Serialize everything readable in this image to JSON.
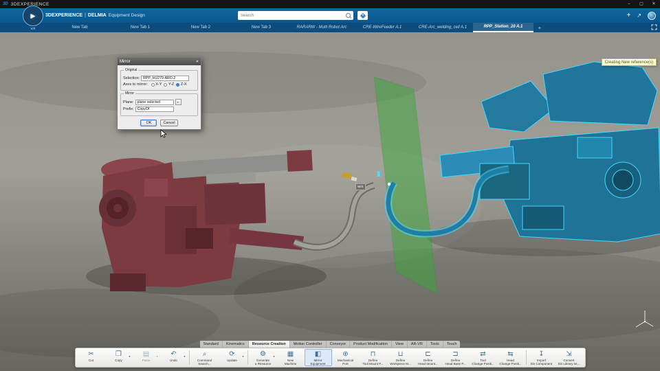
{
  "window": {
    "logo": "3D",
    "title": "3DEXPERIENCE",
    "minimize": "–",
    "maximize": "▢",
    "close": "✕"
  },
  "header": {
    "brand": "3DEXPERIENCE",
    "divider": "|",
    "app": "DELMIA",
    "module": "Equipment Design",
    "search_placeholder": "Search",
    "compass_play": "▶",
    "compass_version": "V.R",
    "actions": {
      "add": "+",
      "share": "↗"
    }
  },
  "tabbar": {
    "tabs": [
      {
        "label": "New Tab"
      },
      {
        "label": "New Tab 1"
      },
      {
        "label": "New Tab 2"
      },
      {
        "label": "New Tab 3"
      },
      {
        "label": "RARARW - Multi Robot Arc",
        "italic": true
      },
      {
        "label": "CRE-WireFeeder A.1",
        "italic": true
      },
      {
        "label": "CRE-Arc_welding_cell A.1",
        "italic": true
      },
      {
        "label": "RPP_Station_20 A.1",
        "italic": true,
        "active": true
      },
      {
        "label": "+",
        "plus": true
      }
    ]
  },
  "viewport": {
    "tooltip": "Creating New reference(s)",
    "frame_label": "W/X",
    "colors": {
      "floor_top": "#95938c",
      "floor_mid": "#a09e97",
      "floor_bottom": "#686660",
      "plane_green": "#3aa83a",
      "red_machine": "#7c3a41",
      "blue_machine": "#1f7396",
      "selection_cyan": "#3fd9ff"
    }
  },
  "dialog": {
    "title": "Mirror",
    "close": "✕",
    "groups": {
      "original": "Original",
      "mirror": "Mirror"
    },
    "selection_label": "Selection:",
    "selection_value": "RPP_HU279-ARO.2",
    "axes_label": "Axes to mirror:",
    "axes": [
      {
        "label": "X-Y"
      },
      {
        "label": "Y-Z"
      },
      {
        "label": "Z-X",
        "selected": true
      }
    ],
    "plane_label": "Plane:",
    "plane_value": "plane selected",
    "picker_glyph": "▸",
    "prefix_label": "Prefix:",
    "prefix_value": "CopyOf",
    "ok": "OK",
    "cancel": "Cancel"
  },
  "ribbon": {
    "caret_glyph": "▾",
    "tabs": [
      {
        "label": "Standard"
      },
      {
        "label": "Kinematics"
      },
      {
        "label": "Resource Creation",
        "active": true
      },
      {
        "label": "Motion Controller"
      },
      {
        "label": "Conveyor"
      },
      {
        "label": "Product Modification"
      },
      {
        "label": "View"
      },
      {
        "label": "AR-VR"
      },
      {
        "label": "Tools"
      },
      {
        "label": "Touch"
      }
    ],
    "tools": [
      {
        "label": "Cut",
        "icon": "scissors-icon",
        "glyph": "✂"
      },
      {
        "label": "Copy",
        "icon": "copy-icon",
        "glyph": "❐",
        "caret": true
      },
      {
        "label": "Paste",
        "icon": "paste-icon",
        "glyph": "▤",
        "caret": true,
        "disabled": true
      },
      {
        "label": "Undo",
        "icon": "undo-icon",
        "glyph": "↶",
        "caret": true
      },
      {
        "sep": true
      },
      {
        "label": "Command\nSearch...",
        "icon": "command-search-icon",
        "glyph": "⌕"
      },
      {
        "label": "Update",
        "icon": "update-icon",
        "glyph": "⟳",
        "caret": true
      },
      {
        "sep": true
      },
      {
        "label": "Generate\na Resource",
        "icon": "generate-resource-icon",
        "glyph": "⚙",
        "caret": true
      },
      {
        "label": "New\nMachine",
        "icon": "new-machine-icon",
        "glyph": "▦"
      },
      {
        "label": "Mirror\nEquipment",
        "icon": "mirror-equipment-icon",
        "glyph": "◧",
        "active": true
      },
      {
        "label": "Mechanical\nPort",
        "icon": "mechanical-port-icon",
        "glyph": "⊕"
      },
      {
        "label": "Define\nTool Mount P...",
        "icon": "define-tool-mount-icon",
        "glyph": "⊓"
      },
      {
        "label": "Define\nWorkpiece M...",
        "icon": "define-workpiece-icon",
        "glyph": "⊔"
      },
      {
        "label": "Define\nHead Mount...",
        "icon": "define-head-mount-icon",
        "glyph": "⊏"
      },
      {
        "label": "Define\nHead Base P...",
        "icon": "define-head-base-icon",
        "glyph": "⊐"
      },
      {
        "label": "Tool\nChange Positi...",
        "icon": "tool-change-position-icon",
        "glyph": "⇄"
      },
      {
        "label": "Head\nChange Positi...",
        "icon": "head-change-position-icon",
        "glyph": "⇆"
      },
      {
        "sep": true
      },
      {
        "label": "Import\nDS Component",
        "icon": "import-ds-component-icon",
        "glyph": "↧"
      },
      {
        "label": "Convert\nDS Library int...",
        "icon": "convert-ds-library-icon",
        "glyph": "⇲"
      }
    ]
  }
}
